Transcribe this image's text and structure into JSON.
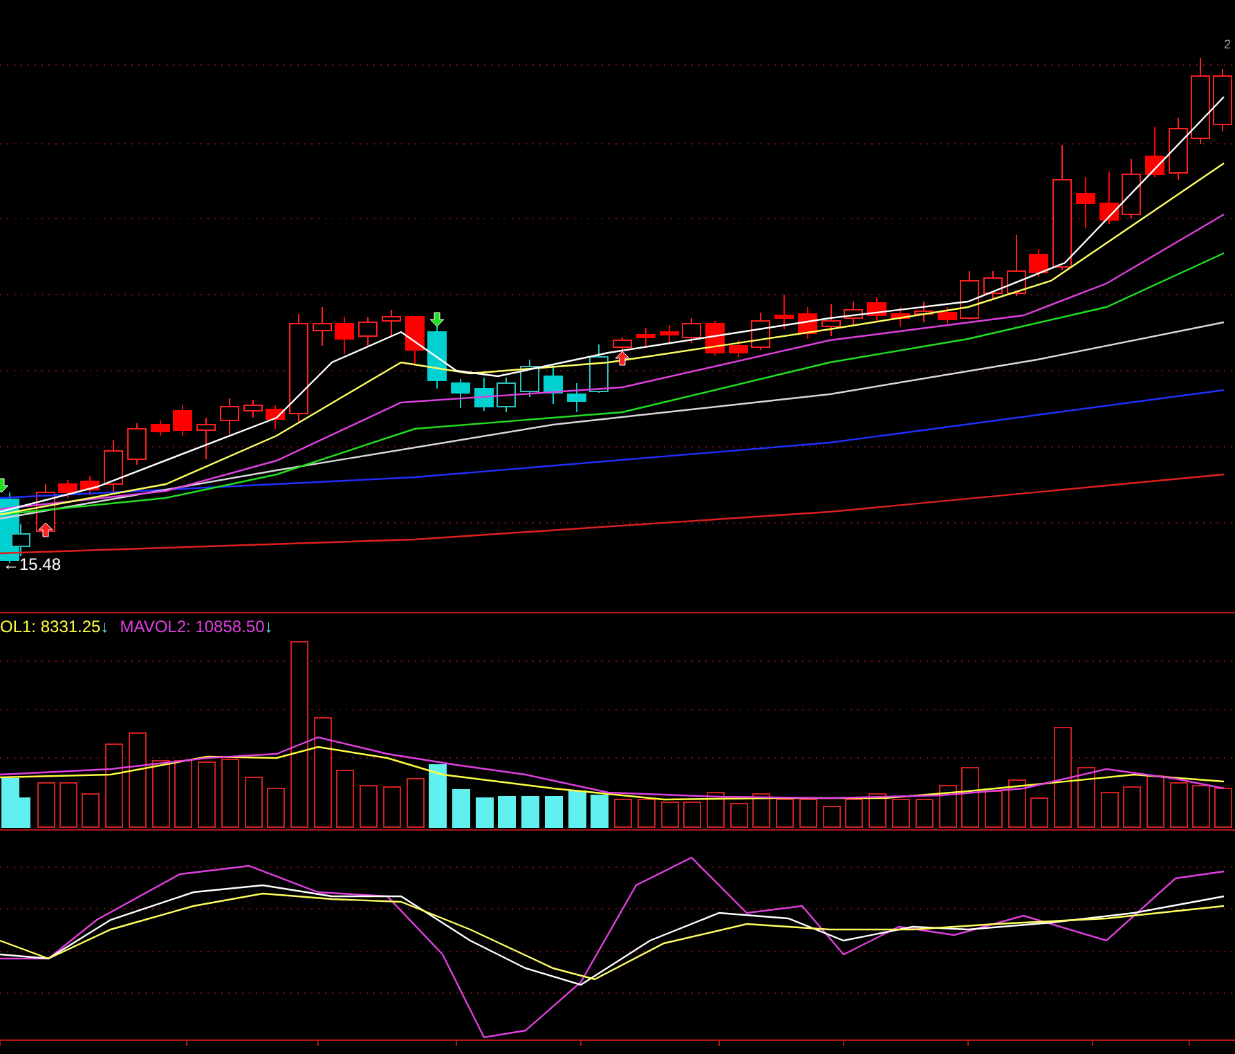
{
  "price_label": "←15.48",
  "corner_label": "2",
  "volume_legend": [
    {
      "kind": "mavol1",
      "text": "OL1: 8331.25"
    },
    {
      "kind": "arrow",
      "text": "↓"
    },
    {
      "kind": "mavol2",
      "text": "MAVOL2: 10858.50"
    },
    {
      "kind": "arrow",
      "text": "↓"
    }
  ]
}
